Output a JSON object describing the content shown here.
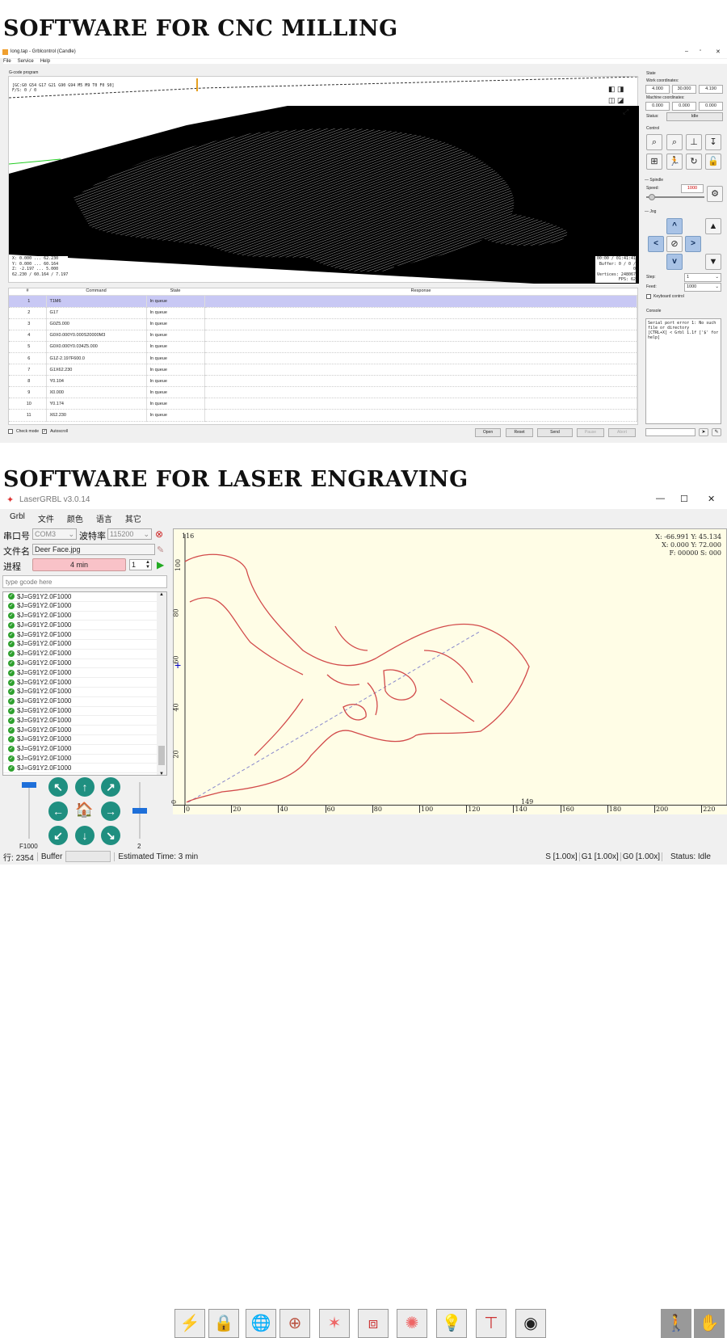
{
  "headings": {
    "cnc": "SOFTWARE FOR  CNC MILLING",
    "laser": "SOFTWARE FOR  LASER ENGRAVING"
  },
  "candle": {
    "title": "long.tap - Grblcontrol  (Candle)",
    "menu": [
      "File",
      "Service",
      "Help"
    ],
    "group_label": "G-code program",
    "gcode_state": "[GC:G0 G54 G17 G21 G90 G94 M5 M9 T0 F0 S0]",
    "fs": "F/S: 0 / 0",
    "ranges": [
      "X: 0.000 ... 62.230",
      "Y: 0.000 ... 60.164",
      "Z: -2.197 ... 5.000",
      "62.230 / 60.164 / 7.197"
    ],
    "info": [
      "00:00 / 01:41:41",
      "Buffer: 0 / 0 / 0",
      "Vertices: 248067",
      "FPS: 62"
    ],
    "table": {
      "headers": [
        "#",
        "Command",
        "State",
        "Response"
      ],
      "rows": [
        [
          "1",
          "T1M6",
          "In queue"
        ],
        [
          "2",
          "G17",
          "In queue"
        ],
        [
          "3",
          "G0Z5.000",
          "In queue"
        ],
        [
          "4",
          "G0X0.000Y0.000S20000M3",
          "In queue"
        ],
        [
          "5",
          "G0X0.000Y0.034Z5.000",
          "In queue"
        ],
        [
          "6",
          "G1Z-2.197F600.0",
          "In queue"
        ],
        [
          "7",
          "G1X62.230",
          "In queue"
        ],
        [
          "8",
          "Y0.104",
          "In queue"
        ],
        [
          "9",
          "X0.000",
          "In queue"
        ],
        [
          "10",
          "Y0.174",
          "In queue"
        ],
        [
          "11",
          "X62.230",
          "In queue"
        ]
      ]
    },
    "check_mode": "Check mode",
    "autoscroll": "Autoscroll",
    "buttons": [
      "Open",
      "Reset",
      "Send",
      "Pause",
      "Abort"
    ],
    "state": {
      "title": "State",
      "work_label": "Work coordinates:",
      "work": [
        "4.000",
        "30.000",
        "4.190"
      ],
      "machine_label": "Machine coordinates:",
      "machine": [
        "0.000",
        "0.000",
        "0.000"
      ],
      "status_label": "Status:",
      "status": "Idle"
    },
    "control_title": "Control",
    "spindle": {
      "title": "Spindle",
      "speed_label": "Speed:",
      "speed": "1000"
    },
    "jog": {
      "title": "Jog",
      "step_label": "Step:",
      "step": "1",
      "feed_label": "Feed:",
      "feed": "1000",
      "keyboard": "Keyboard control"
    },
    "console": {
      "title": "Console",
      "text": "Serial port error 1: No such file or directory\n[CTRL+X] < Grbl 1.1f ['$' for help]"
    }
  },
  "laser": {
    "title": "LaserGRBL v3.0.14",
    "menu": [
      "Grbl",
      "文件",
      "颜色",
      "语言",
      "其它"
    ],
    "port_label": "串口号",
    "port": "COM3",
    "baud_label": "波特率",
    "baud": "115200",
    "file_label": "文件名",
    "file": "Deer Face.jpg",
    "progress_label": "进程",
    "progress_text": "4 min",
    "progress": 0,
    "passes": "1",
    "gcode_placeholder": "type gcode here",
    "lines": [
      "$J=G91Y2.0F1000",
      "$J=G91Y2.0F1000",
      "$J=G91Y2.0F1000",
      "$J=G91Y2.0F1000",
      "$J=G91Y2.0F1000",
      "$J=G91Y2.0F1000",
      "$J=G91Y2.0F1000",
      "$J=G91Y2.0F1000",
      "$J=G91Y2.0F1000",
      "$J=G91Y2.0F1000",
      "$J=G91Y2.0F1000",
      "$J=G91Y2.0F1000",
      "$J=G91Y2.0F1000",
      "$J=G91Y2.0F1000",
      "$J=G91Y2.0F1000",
      "$J=G91Y2.0F1000",
      "$J=G91Y2.0F1000",
      "$J=G91Y2.0F1000",
      "$J=G91Y2.0F1000"
    ],
    "feed": "F1000",
    "step": "2",
    "coords": [
      "X: -66.991 Y: 45.134",
      "X: 0.000 Y: 72.000",
      "F: 00000 S: 000"
    ],
    "y_max": "116",
    "x_max": "149",
    "x_ticks": [
      "0",
      "20",
      "40",
      "60",
      "80",
      "100",
      "120",
      "140",
      "160",
      "180",
      "200",
      "220"
    ],
    "y_ticks": [
      "100",
      "80",
      "60",
      "40",
      "20",
      "0"
    ],
    "status": {
      "line_label": "行:",
      "line": "2354",
      "buffer": "Buffer",
      "est": "Estimated Time:  3 min",
      "s": "S [1.00x]",
      "g1": "G1 [1.00x]",
      "g0": "G0 [1.00x]",
      "status": "Status:  Idle"
    }
  }
}
